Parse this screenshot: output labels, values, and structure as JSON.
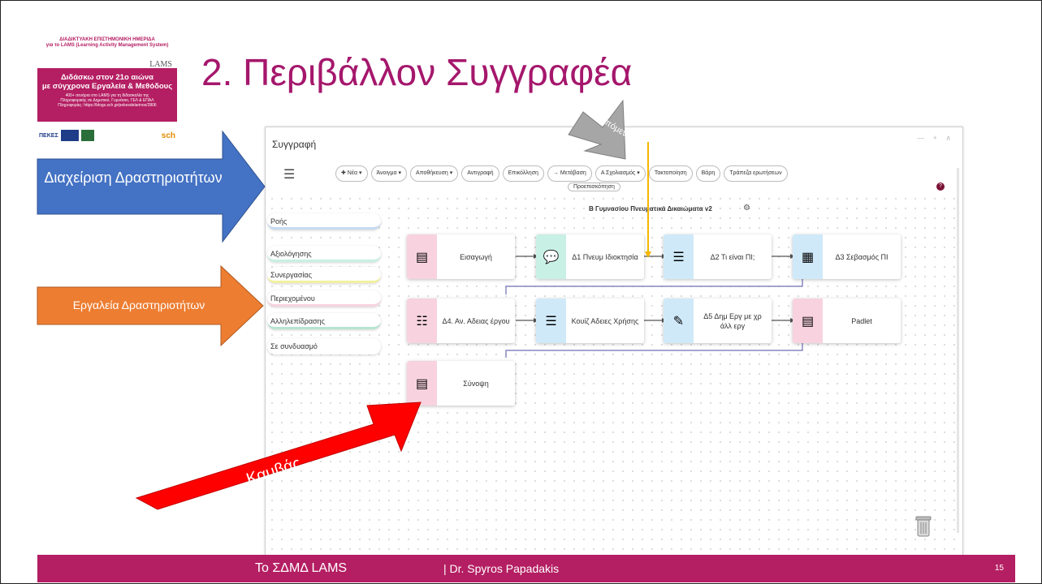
{
  "slide": {
    "title": "2. Περιβάλλον Συγγραφέα",
    "footer_left": "Το ΣΔΜΔ LAMS",
    "footer_author": "| Dr. Spyros Papadakis",
    "page_number": "15"
  },
  "poster": {
    "line1": "ΔΙΑΔΙΚΤΥΑΚΗ ΕΠΙΣΤΗΜΟΝΙΚΗ ΗΜΕΡΙΔΑ",
    "line2": "για το LAMS (Learning Activity Management System)",
    "lams": "LAMS",
    "headline1": "Διδάσκω στον 21ο αιώνα",
    "headline2": "με σύγχρονα Εργαλεία & Μεθόδους",
    "sub1": "400+ σενάρια στο LAMS για τη διδασκαλία της",
    "sub2": "Πληροφορικής σε Δημοτικό, Γυμνάσιο, ΓΕΛ & ΕΠΑΛ",
    "info": "Πληροφορίες: https://blogs.sch.gr/pekesdelarinos/2806",
    "logo1": "ΠΕΚΕΣ",
    "logo2": "sch"
  },
  "callouts": {
    "blue": "Διαχείριση Δραστηριοτήτων",
    "orange": "Εργαλεία Δραστηριοτήτων",
    "gray": "Επόμενη",
    "red": "Καμβάς"
  },
  "app": {
    "title": "Συγγραφή",
    "toolbar": [
      "✚ Νέα ▾",
      "Άνοιγμα ▾",
      "Αποθήκευση ▾",
      "Αντιγραφή",
      "Επικόλληση",
      "→ Μετάβαση",
      "A Σχολιασμός ▾",
      "Τακτοποίηση",
      "Βάρη",
      "Τράπεζα ερωτήσεων"
    ],
    "preview": "Προεπισκόπηση",
    "sequence_title": "Β Γυμνασίου Πνευματικά Δικαιώματα v2",
    "categories": [
      "Ροής",
      "Αξιολόγησης",
      "Συνεργασίας",
      "Περιεχομένου",
      "Αλληλεπίδρασης",
      "Σε συνδυασμό"
    ],
    "activities": [
      {
        "label": "Εισαγωγή",
        "color": "pink"
      },
      {
        "label": "Δ1 Πνευμ Ιδιοκτησία",
        "color": "green"
      },
      {
        "label": "Δ2 Τι είναι ΠΙ;",
        "color": "blue"
      },
      {
        "label": "Δ3 Σεβασμός ΠΙ",
        "color": "blue"
      },
      {
        "label": "Δ4. Αν. Αδειας έργου",
        "color": "pink"
      },
      {
        "label": "Κουίζ Αδειες Χρήσης",
        "color": "blue"
      },
      {
        "label": "Δ5 Δημ Εργ με χρ άλλ εργ",
        "color": "blue"
      },
      {
        "label": "Padlet",
        "color": "pink"
      },
      {
        "label": "Σύνοψη",
        "color": "pink"
      }
    ]
  },
  "colors": {
    "accent": "#b41e62",
    "blue_arrow": "#4472c4",
    "orange_arrow": "#ed7d31",
    "red_arrow": "#ff0000",
    "gray_arrow": "#a6a6a6"
  }
}
